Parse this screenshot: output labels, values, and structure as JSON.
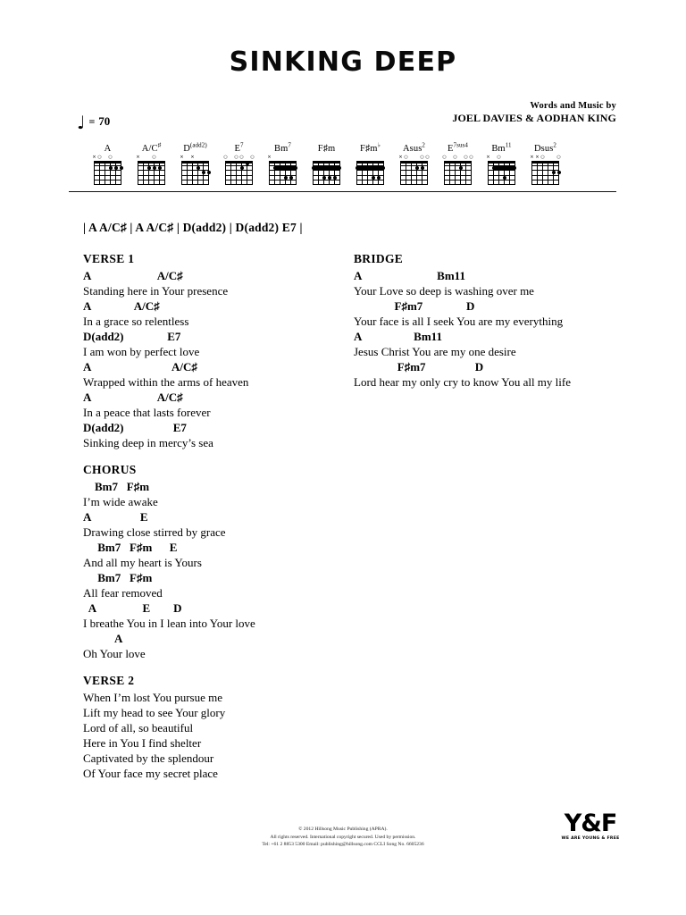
{
  "document": {
    "title": "SINKING DEEP",
    "credits": {
      "words_by": "Words and Music by",
      "authors": "JOEL DAVIES & AODHAN KING"
    },
    "tempo": {
      "note_glyph": "♩",
      "equals": "=",
      "bpm": "70"
    }
  },
  "chord_chart": {
    "chords": [
      {
        "name": "A",
        "sup": "",
        "markers": "xo o  o",
        "label_plain": "A"
      },
      {
        "name": "A/C",
        "sup": "♯",
        "markers": "x  o   ",
        "label_plain": "A/C#"
      },
      {
        "name": "D",
        "sup": "(add2)",
        "markers": "x x   o",
        "label_plain": "D(add2)"
      },
      {
        "name": "E",
        "sup": "7",
        "markers": "o oo oo",
        "label_plain": "E7"
      },
      {
        "name": "Bm",
        "sup": "7",
        "markers": "x      ",
        "label_plain": "Bm7"
      },
      {
        "name": "F♯m",
        "sup": "",
        "markers": "       ",
        "label_plain": "F#m"
      },
      {
        "name": "F♯m",
        "sup": "♭",
        "markers": "       ",
        "label_plain": "F#m b"
      },
      {
        "name": "Asus",
        "sup": "2",
        "markers": "xo  oo ",
        "label_plain": "Asus2"
      },
      {
        "name": "E",
        "sup": "7sus4",
        "markers": "o o oo ",
        "label_plain": "E7sus4"
      },
      {
        "name": "Bm",
        "sup": "11",
        "markers": "x o    ",
        "label_plain": "Bm11"
      },
      {
        "name": "Dsus",
        "sup": "2",
        "markers": "xxo  o ",
        "label_plain": "Dsus2"
      }
    ]
  },
  "intro": {
    "bar_line": "| A A/C♯ | A A/C♯ | D(add2) | D(add2) E7 |"
  },
  "sections": {
    "verse1": {
      "heading": "VERSE 1",
      "lines": [
        {
          "chords": "A                       A/C♯",
          "lyric": "Standing here in Your presence"
        },
        {
          "chords": "A               A/C♯",
          "lyric": "In a grace so relentless"
        },
        {
          "chords": "D(add2)               E7",
          "lyric": "I am won by perfect love"
        },
        {
          "chords": "A                            A/C♯",
          "lyric": "Wrapped within the arms of heaven"
        },
        {
          "chords": "A                       A/C♯",
          "lyric": "In a peace that lasts forever"
        },
        {
          "chords": "D(add2)                 E7",
          "lyric": "Sinking deep in mercy’s sea"
        }
      ]
    },
    "chorus": {
      "heading": "CHORUS",
      "lines": [
        {
          "chords": "    Bm7   F♯m",
          "lyric": "I’m wide awake"
        },
        {
          "chords": "A                 E",
          "lyric": "Drawing close stirred by grace"
        },
        {
          "chords": "     Bm7   F♯m      E",
          "lyric": "And all my heart is Yours"
        },
        {
          "chords": "     Bm7   F♯m",
          "lyric": "All fear removed"
        },
        {
          "chords": "  A                E        D",
          "lyric": "I breathe You in I lean into Your love"
        },
        {
          "chords": "           A",
          "lyric": "Oh Your love"
        }
      ]
    },
    "verse2": {
      "heading": "VERSE 2",
      "lines": [
        {
          "chords": "",
          "lyric": "When I’m lost You pursue me"
        },
        {
          "chords": "",
          "lyric": "Lift my head to see Your glory"
        },
        {
          "chords": "",
          "lyric": "Lord of all, so beautiful"
        },
        {
          "chords": "",
          "lyric": "Here in You I find shelter"
        },
        {
          "chords": "",
          "lyric": "Captivated by the splendour"
        },
        {
          "chords": "",
          "lyric": "Of Your face my secret place"
        }
      ]
    },
    "bridge": {
      "heading": "BRIDGE",
      "lines": [
        {
          "chords": "A                          Bm11",
          "lyric": "Your Love so deep is washing over me"
        },
        {
          "chords": "              F♯m7               D",
          "lyric": "Your face is all I seek You are my everything"
        },
        {
          "chords": "A                  Bm11",
          "lyric": "Jesus Christ You are my one desire"
        },
        {
          "chords": "               F♯m7                 D",
          "lyric": "Lord hear my only cry to know You all my life"
        }
      ]
    }
  },
  "footer": {
    "line1": "© 2012 Hillsong Music Publishing (APRA).",
    "line2": "All rights reserved. International copyright secured. Used by permission.",
    "line3": "Tel: +61 2 8853 5300  Email: publishing@hillsong.com  CCLI Song No. 6605236",
    "logo_mark": "Y&F",
    "logo_tagline": "WE ARE YOUNG & FREE"
  }
}
